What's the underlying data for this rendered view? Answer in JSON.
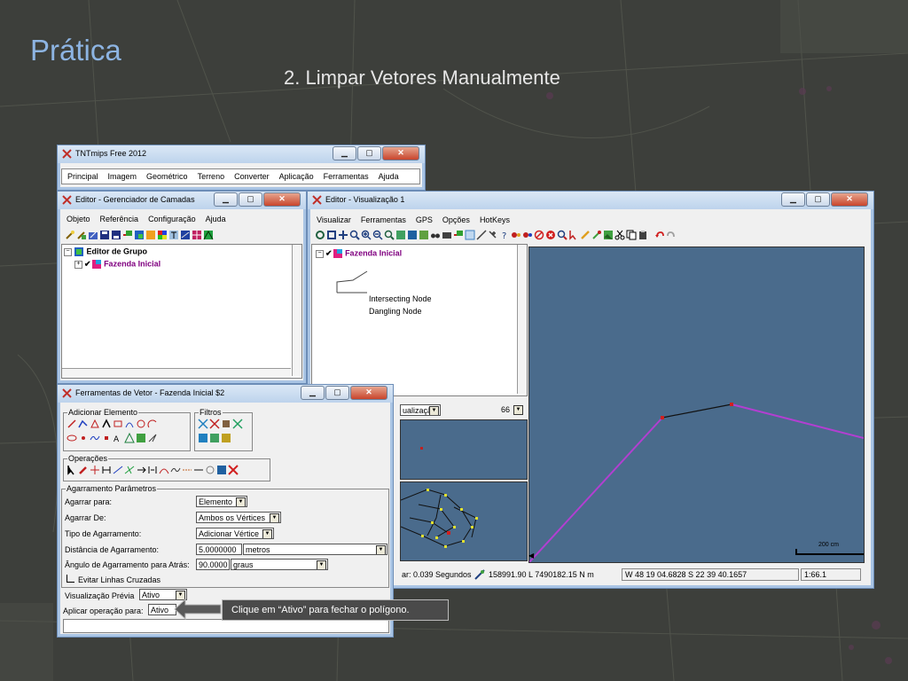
{
  "slide": {
    "title": "Prática",
    "subtitle": "2. Limpar Vetores Manualmente"
  },
  "main_window": {
    "title": "TNTmips Free 2012",
    "menu": [
      "Principal",
      "Imagem",
      "Geométrico",
      "Terreno",
      "Converter",
      "Aplicação",
      "Ferramentas",
      "Ajuda"
    ]
  },
  "layer_manager": {
    "title": "Editor - Gerenciador de Camadas",
    "menu": [
      "Objeto",
      "Referência",
      "Configuração",
      "Ajuda"
    ],
    "tree": {
      "group_label": "Editor de Grupo",
      "layer_label": "Fazenda Inicial"
    }
  },
  "viewer": {
    "title": "Editor - Visualização 1",
    "menu": [
      "Visualizar",
      "Ferramentas",
      "GPS",
      "Opções",
      "HotKeys"
    ],
    "layer_label": "Fazenda Inicial",
    "legend": [
      "Intersecting Node",
      "Dangling Node"
    ],
    "view_dropdown": "ualização",
    "zoom_value": "66",
    "scale_label": "200 cm",
    "status": {
      "time": "ar: 0.039 Segundos",
      "coords": "158991.90 L  7490182.15 N m",
      "geo": "W 48 19 04.6828  S 22 39 40.1657",
      "scale": "1:66.1"
    },
    "colors": {
      "map_bg": "#4a6b8c",
      "line_magenta": "#b23fd1"
    }
  },
  "vector_tools": {
    "title": "Ferramentas de Vetor - Fazenda Inicial $2",
    "groups": {
      "add": "Adicionar Elemento",
      "filters": "Filtros",
      "ops": "Operações",
      "snap": "Agarramento Parâmetros"
    },
    "fields": {
      "snap_to_label": "Agarrar para:",
      "snap_to_value": "Elemento",
      "snap_from_label": "Agarrar De:",
      "snap_from_value": "Ambos os Vértices",
      "snap_type_label": "Tipo de Agarramento:",
      "snap_type_value": "Adicionar Vértice",
      "distance_label": "Distância de Agarramento:",
      "distance_value": "5.0000000",
      "distance_unit": "metros",
      "angle_label": "Ângulo de Agarramento para Atrás:",
      "angle_value": "90.0000",
      "angle_unit": "graus",
      "avoid_crossing": "Evitar Linhas Cruzadas",
      "preview_label": "Visualização Prévia",
      "preview_value": "Ativo",
      "apply_label": "Aplicar operação para:",
      "apply_value": "Ativo"
    }
  },
  "callout": {
    "text": "Clique em “Ativo” para fechar o polígono."
  }
}
